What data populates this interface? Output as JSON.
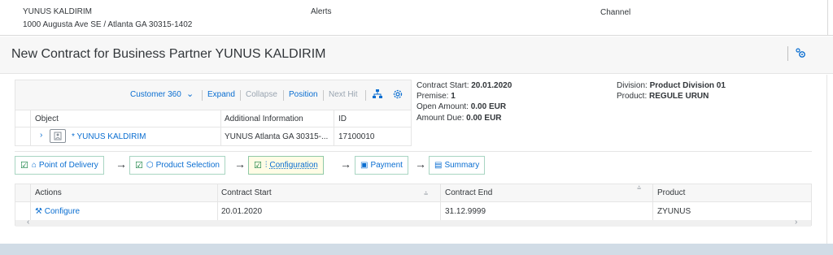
{
  "header": {
    "partner_name": "YUNUS KALDIRIM",
    "partner_address": "1000 Augusta Ave SE / Atlanta GA 30315-1402",
    "alerts_label": "Alerts",
    "channel_label": "Channel"
  },
  "page": {
    "title": "New Contract for Business Partner YUNUS KALDIRIM",
    "title_icon": "settings-personalize-icon"
  },
  "customer_panel": {
    "toolbar": {
      "customer360_label": "Customer 360",
      "expand_label": "Expand",
      "collapse_label": "Collapse",
      "position_label": "Position",
      "next_hit_label": "Next Hit"
    },
    "columns": [
      "Object",
      "Additional Information",
      "ID"
    ],
    "row": {
      "object": "* YUNUS KALDIRIM",
      "additional_info": "YUNUS Atlanta GA 30315-...",
      "id": "17100010"
    }
  },
  "contract_info": {
    "contract_start_label": "Contract Start:",
    "contract_start_value": "20.01.2020",
    "premise_label": "Premise:",
    "premise_value": "1",
    "open_amount_label": "Open Amount:",
    "open_amount_value": "0.00 EUR",
    "amount_due_label": "Amount Due:",
    "amount_due_value": "0.00 EUR",
    "division_label": "Division:",
    "division_value": "Product Division 01",
    "product_label": "Product:",
    "product_value": "REGULE URUN"
  },
  "steps": [
    {
      "label": "Point of Delivery",
      "icon": "home-icon",
      "checked": true
    },
    {
      "label": "Product Selection",
      "icon": "product-icon",
      "checked": true
    },
    {
      "label": "Configuration",
      "icon": "sliders-icon",
      "checked": true,
      "active": true
    },
    {
      "label": "Payment",
      "icon": "payment-icon",
      "checked": false
    },
    {
      "label": "Summary",
      "icon": "summary-icon",
      "checked": false
    }
  ],
  "config_table": {
    "columns": [
      "Actions",
      "Contract Start",
      "Contract End",
      "Product"
    ],
    "row": {
      "action": "Configure",
      "contract_start": "20.01.2020",
      "contract_end": "31.12.9999",
      "product": "ZYUNUS"
    }
  },
  "colors": {
    "link": "#0a6ed1",
    "step_border": "#a9d5c2",
    "active_step_bg": "#fffce5",
    "check_green": "#107e3e",
    "footer": "#d1dce6"
  }
}
